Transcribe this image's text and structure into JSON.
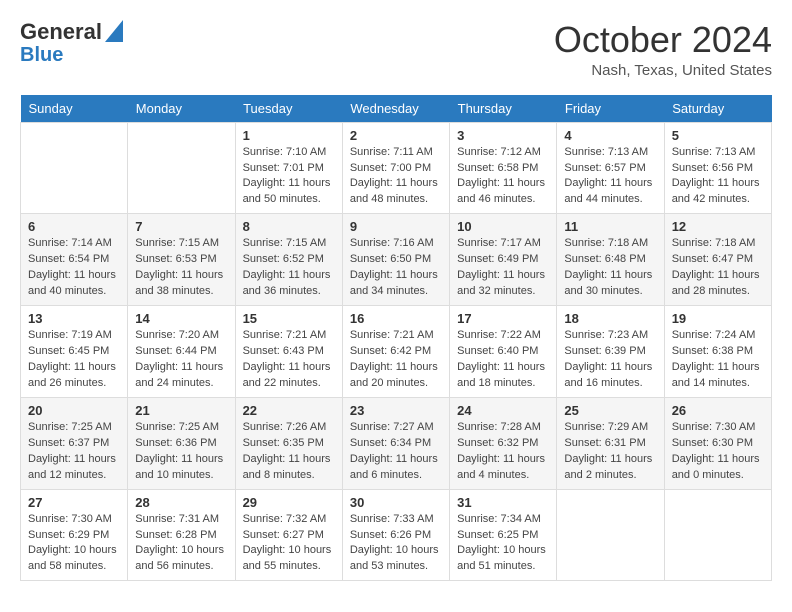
{
  "header": {
    "logo_line1": "General",
    "logo_line2": "Blue",
    "month_title": "October 2024",
    "location": "Nash, Texas, United States"
  },
  "days_of_week": [
    "Sunday",
    "Monday",
    "Tuesday",
    "Wednesday",
    "Thursday",
    "Friday",
    "Saturday"
  ],
  "weeks": [
    [
      {
        "day": "",
        "info": ""
      },
      {
        "day": "",
        "info": ""
      },
      {
        "day": "1",
        "info": "Sunrise: 7:10 AM\nSunset: 7:01 PM\nDaylight: 11 hours and 50 minutes."
      },
      {
        "day": "2",
        "info": "Sunrise: 7:11 AM\nSunset: 7:00 PM\nDaylight: 11 hours and 48 minutes."
      },
      {
        "day": "3",
        "info": "Sunrise: 7:12 AM\nSunset: 6:58 PM\nDaylight: 11 hours and 46 minutes."
      },
      {
        "day": "4",
        "info": "Sunrise: 7:13 AM\nSunset: 6:57 PM\nDaylight: 11 hours and 44 minutes."
      },
      {
        "day": "5",
        "info": "Sunrise: 7:13 AM\nSunset: 6:56 PM\nDaylight: 11 hours and 42 minutes."
      }
    ],
    [
      {
        "day": "6",
        "info": "Sunrise: 7:14 AM\nSunset: 6:54 PM\nDaylight: 11 hours and 40 minutes."
      },
      {
        "day": "7",
        "info": "Sunrise: 7:15 AM\nSunset: 6:53 PM\nDaylight: 11 hours and 38 minutes."
      },
      {
        "day": "8",
        "info": "Sunrise: 7:15 AM\nSunset: 6:52 PM\nDaylight: 11 hours and 36 minutes."
      },
      {
        "day": "9",
        "info": "Sunrise: 7:16 AM\nSunset: 6:50 PM\nDaylight: 11 hours and 34 minutes."
      },
      {
        "day": "10",
        "info": "Sunrise: 7:17 AM\nSunset: 6:49 PM\nDaylight: 11 hours and 32 minutes."
      },
      {
        "day": "11",
        "info": "Sunrise: 7:18 AM\nSunset: 6:48 PM\nDaylight: 11 hours and 30 minutes."
      },
      {
        "day": "12",
        "info": "Sunrise: 7:18 AM\nSunset: 6:47 PM\nDaylight: 11 hours and 28 minutes."
      }
    ],
    [
      {
        "day": "13",
        "info": "Sunrise: 7:19 AM\nSunset: 6:45 PM\nDaylight: 11 hours and 26 minutes."
      },
      {
        "day": "14",
        "info": "Sunrise: 7:20 AM\nSunset: 6:44 PM\nDaylight: 11 hours and 24 minutes."
      },
      {
        "day": "15",
        "info": "Sunrise: 7:21 AM\nSunset: 6:43 PM\nDaylight: 11 hours and 22 minutes."
      },
      {
        "day": "16",
        "info": "Sunrise: 7:21 AM\nSunset: 6:42 PM\nDaylight: 11 hours and 20 minutes."
      },
      {
        "day": "17",
        "info": "Sunrise: 7:22 AM\nSunset: 6:40 PM\nDaylight: 11 hours and 18 minutes."
      },
      {
        "day": "18",
        "info": "Sunrise: 7:23 AM\nSunset: 6:39 PM\nDaylight: 11 hours and 16 minutes."
      },
      {
        "day": "19",
        "info": "Sunrise: 7:24 AM\nSunset: 6:38 PM\nDaylight: 11 hours and 14 minutes."
      }
    ],
    [
      {
        "day": "20",
        "info": "Sunrise: 7:25 AM\nSunset: 6:37 PM\nDaylight: 11 hours and 12 minutes."
      },
      {
        "day": "21",
        "info": "Sunrise: 7:25 AM\nSunset: 6:36 PM\nDaylight: 11 hours and 10 minutes."
      },
      {
        "day": "22",
        "info": "Sunrise: 7:26 AM\nSunset: 6:35 PM\nDaylight: 11 hours and 8 minutes."
      },
      {
        "day": "23",
        "info": "Sunrise: 7:27 AM\nSunset: 6:34 PM\nDaylight: 11 hours and 6 minutes."
      },
      {
        "day": "24",
        "info": "Sunrise: 7:28 AM\nSunset: 6:32 PM\nDaylight: 11 hours and 4 minutes."
      },
      {
        "day": "25",
        "info": "Sunrise: 7:29 AM\nSunset: 6:31 PM\nDaylight: 11 hours and 2 minutes."
      },
      {
        "day": "26",
        "info": "Sunrise: 7:30 AM\nSunset: 6:30 PM\nDaylight: 11 hours and 0 minutes."
      }
    ],
    [
      {
        "day": "27",
        "info": "Sunrise: 7:30 AM\nSunset: 6:29 PM\nDaylight: 10 hours and 58 minutes."
      },
      {
        "day": "28",
        "info": "Sunrise: 7:31 AM\nSunset: 6:28 PM\nDaylight: 10 hours and 56 minutes."
      },
      {
        "day": "29",
        "info": "Sunrise: 7:32 AM\nSunset: 6:27 PM\nDaylight: 10 hours and 55 minutes."
      },
      {
        "day": "30",
        "info": "Sunrise: 7:33 AM\nSunset: 6:26 PM\nDaylight: 10 hours and 53 minutes."
      },
      {
        "day": "31",
        "info": "Sunrise: 7:34 AM\nSunset: 6:25 PM\nDaylight: 10 hours and 51 minutes."
      },
      {
        "day": "",
        "info": ""
      },
      {
        "day": "",
        "info": ""
      }
    ]
  ]
}
